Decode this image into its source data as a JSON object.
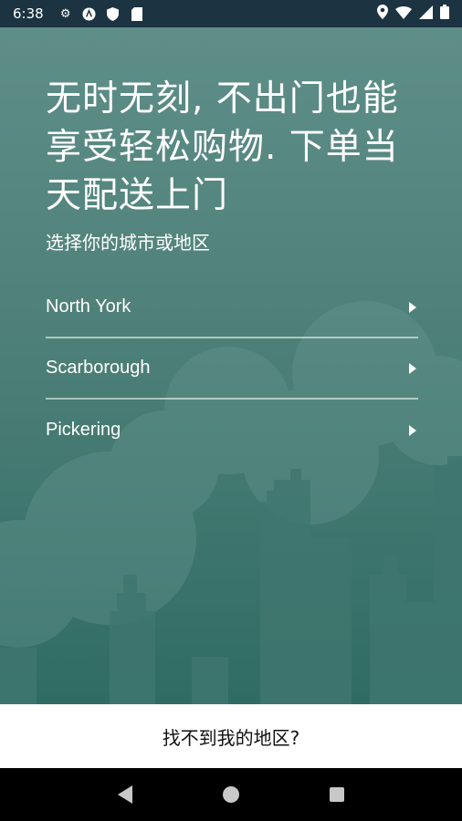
{
  "status_bar": {
    "time": "6:38",
    "icons_left": [
      "gear-icon",
      "a-badge-icon",
      "shield-icon",
      "sd-card-icon"
    ],
    "icons_right": [
      "location-icon",
      "wifi-icon",
      "signal-icon",
      "battery-icon"
    ]
  },
  "main": {
    "headline": "无时无刻, 不出门也能享受轻松购物. 下单当天配送上门",
    "subtitle": "选择你的城市或地区",
    "cities": [
      {
        "label": "North York"
      },
      {
        "label": "Scarborough"
      },
      {
        "label": "Pickering"
      }
    ]
  },
  "footer": {
    "label": "找不到我的地区?"
  },
  "nav": {
    "buttons": [
      "back",
      "home",
      "recents"
    ]
  },
  "colors": {
    "status_bar": "#1c3341",
    "background_top": "#5f8e89",
    "background_bottom": "#2f6c64"
  }
}
